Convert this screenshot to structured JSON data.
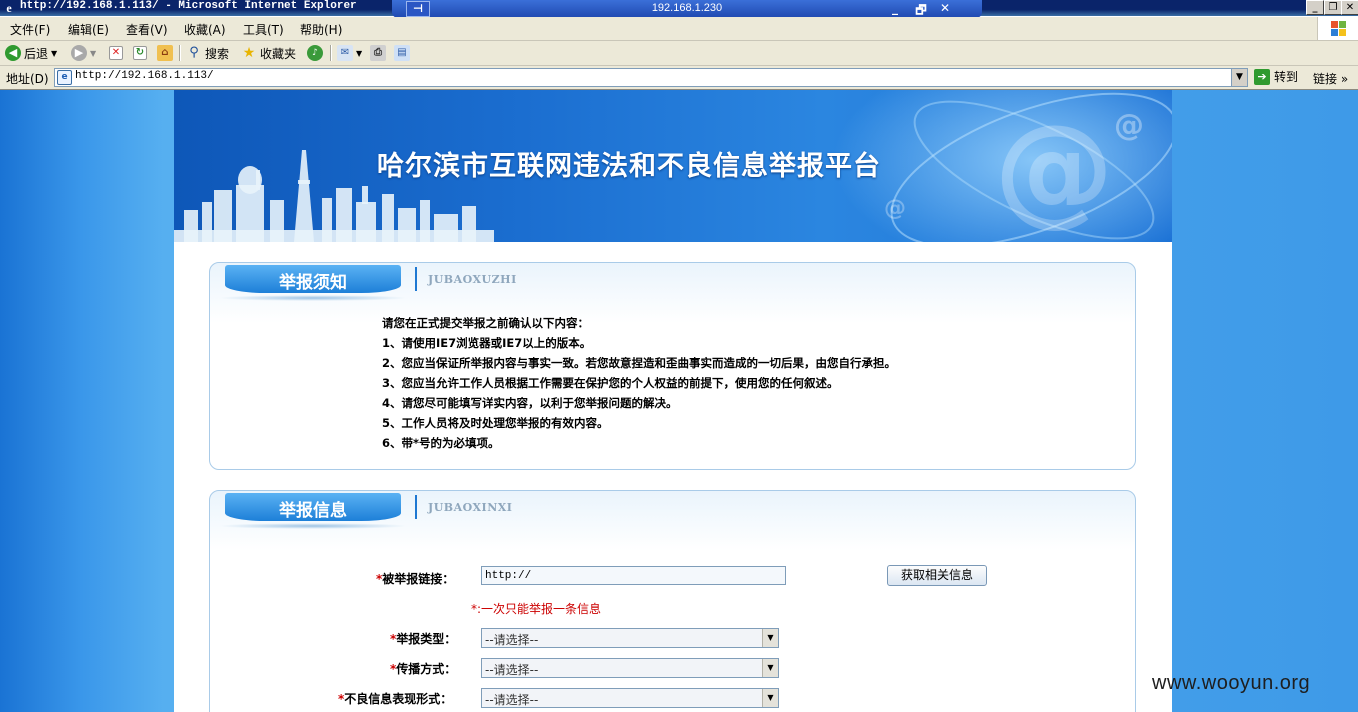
{
  "window": {
    "title": "http://192.168.1.113/ - Microsoft Internet Explorer",
    "remote_host": "192.168.1.230",
    "rd_pin": "⊣",
    "rd_minimize": "_",
    "rd_restore": "🗗",
    "rd_close": "✕",
    "win_minimize": "_",
    "win_restore": "❐",
    "win_close": "✕"
  },
  "menu": {
    "items": [
      "文件(F)",
      "编辑(E)",
      "查看(V)",
      "收藏(A)",
      "工具(T)",
      "帮助(H)"
    ]
  },
  "toolbar": {
    "back_label": "后退",
    "search_label": "搜索",
    "favorites_label": "收藏夹"
  },
  "address": {
    "label": "地址(D)",
    "url": "http://192.168.1.113/",
    "go_label": "转到",
    "links_label": "链接 »"
  },
  "banner": {
    "title": "哈尔滨市互联网违法和不良信息举报平台"
  },
  "notice_section": {
    "title": "举报须知",
    "subtitle": "JUBAOXUZHI",
    "intro": "请您在正式提交举报之前确认以下内容：",
    "items": [
      "1、请使用IE7浏览器或IE7以上的版本。",
      "2、您应当保证所举报内容与事实一致。若您故意捏造和歪曲事实而造成的一切后果，由您自行承担。",
      "3、您应当允许工作人员根据工作需要在保护您的个人权益的前提下，使用您的任何叙述。",
      "4、请您尽可能填写详实内容，以利于您举报问题的解决。",
      "5、工作人员将及时处理您举报的有效内容。",
      "6、带*号的为必填项。"
    ]
  },
  "info_section": {
    "title": "举报信息",
    "subtitle": "JUBAOXINXI",
    "required_mark": "*",
    "url_label": "被举报链接：",
    "url_value": "http://",
    "fetch_button": "获取相关信息",
    "hint": "*:一次只能举报一条信息",
    "type_label": "举报类型：",
    "type_value": "--请选择--",
    "spread_label": "传播方式：",
    "spread_value": "--请选择--",
    "form_label": "不良信息表现形式：",
    "form_value": "--请选择--"
  },
  "watermark": "www.wooyun.org",
  "colors": {
    "accent": "#1d7fd8",
    "required": "#cc0000"
  }
}
